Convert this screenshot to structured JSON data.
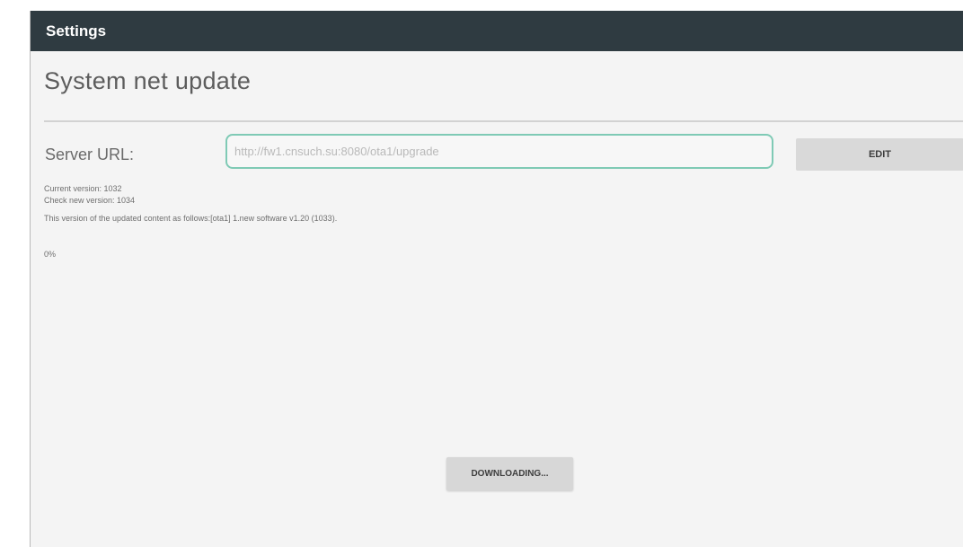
{
  "titlebar": {
    "title": "Settings"
  },
  "page": {
    "title": "System net update"
  },
  "server": {
    "label": "Server URL:",
    "url_value": "http://fw1.cnsuch.su:8080/ota1/upgrade",
    "edit_label": "EDIT"
  },
  "info": {
    "current_version": "Current version: 1032",
    "check_version": "Check new version: 1034",
    "description": "This version of the updated content as follows:[ota1] 1.new software v1.20 (1033).",
    "progress": "0%"
  },
  "download": {
    "button_label": "DOWNLOADING..."
  },
  "colors": {
    "titlebar_bg": "#2f3b41",
    "input_border": "#7fcab5",
    "background": "#f4f4f4"
  }
}
